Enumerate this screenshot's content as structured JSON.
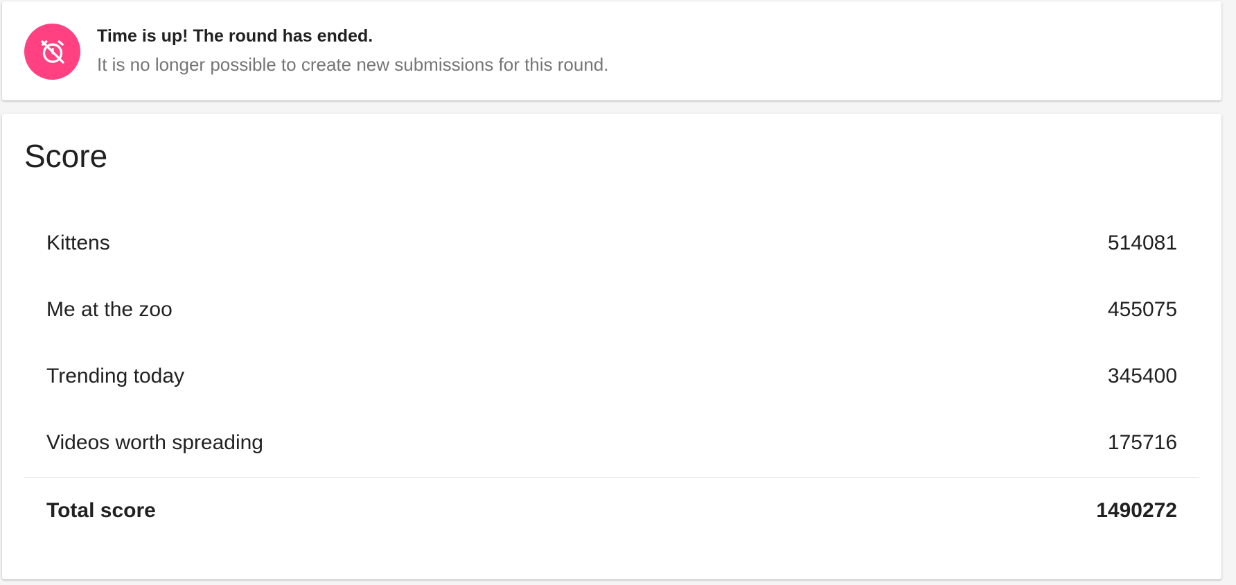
{
  "notice": {
    "icon": "alarm-off-icon",
    "icon_bg_color": "#ff4081",
    "title": "Time is up! The round has ended.",
    "message": "It is no longer possible to create new submissions for this round."
  },
  "score": {
    "title": "Score",
    "rows": [
      {
        "label": "Kittens",
        "value": "514081"
      },
      {
        "label": "Me at the zoo",
        "value": "455075"
      },
      {
        "label": "Trending today",
        "value": "345400"
      },
      {
        "label": "Videos worth spreading",
        "value": "175716"
      }
    ],
    "total": {
      "label": "Total score",
      "value": "1490272"
    }
  }
}
